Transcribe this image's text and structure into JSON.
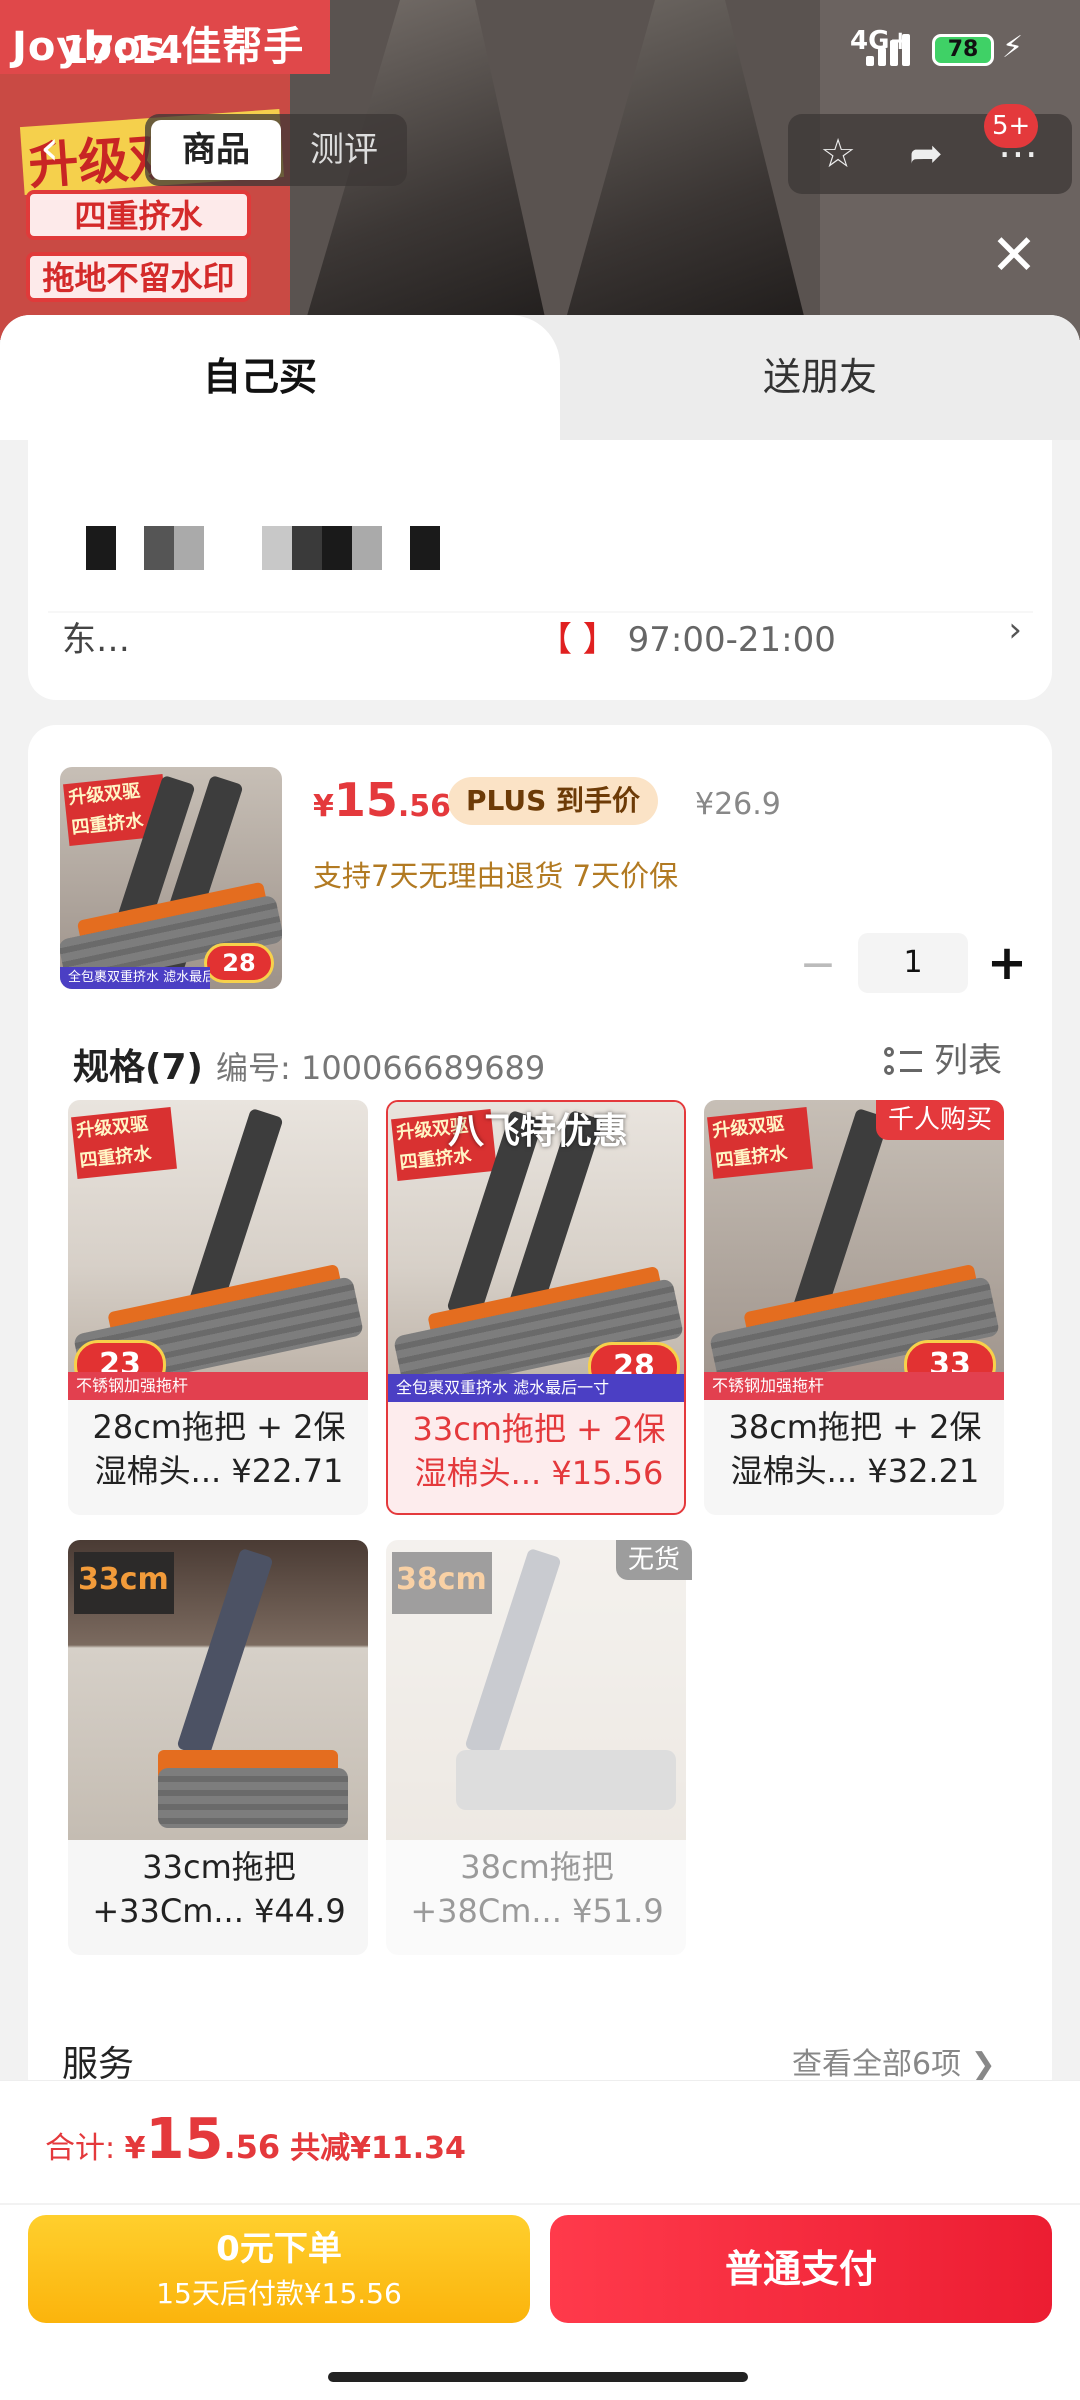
{
  "status_bar": {
    "time": "17:14",
    "network": "4G+",
    "battery": "78"
  },
  "background_page": {
    "brand": "Joybos 佳帮手",
    "slogan": "升级双驱",
    "tags": [
      "四重挤水",
      "拖地不留水印"
    ]
  },
  "navbar": {
    "tabs": [
      {
        "label": "商品",
        "active": true
      },
      {
        "label": "测评",
        "active": false
      }
    ],
    "cart_badge": "5+"
  },
  "sheet": {
    "tabs": [
      {
        "label": "自己买",
        "active": true
      },
      {
        "label": "送朋友",
        "active": false
      }
    ]
  },
  "address": {
    "row2_prefix": "东…",
    "delivery_text": "97:00-21:00",
    "delivery_prefix": "【 】"
  },
  "product": {
    "price_currency": "¥",
    "price_int": "15",
    "price_dec": ".56",
    "plus_label": "PLUS 到手价",
    "original_price": "¥26.9",
    "promise": "支持7天无理由退货  7天价保",
    "quantity": "1",
    "thumb_tag_price": "28",
    "thumb_strip": "全包裹双重挤水 滤水最后一寸"
  },
  "specs": {
    "title": "规格(7)",
    "number_label": "编号: 100066689689",
    "list_toggle": "列表",
    "items": [
      {
        "line1": "28cm拖把 + 2保",
        "line2": "湿棉头...  ¥22.71",
        "tag_price": "23",
        "strip": "不锈钢加强拖杆",
        "selected": false,
        "corner": "",
        "overlay": ""
      },
      {
        "line1": "33cm拖把 + 2保",
        "line2": "湿棉头...  ¥15.56",
        "tag_price": "28",
        "strip": "全包裹双重挤水 滤水最后一寸",
        "selected": true,
        "corner": "",
        "overlay": "八飞特优惠"
      },
      {
        "line1": "38cm拖把 + 2保",
        "line2": "湿棉头...  ¥32.21",
        "tag_price": "33",
        "strip": "不锈钢加强拖杆",
        "selected": false,
        "corner": "千人购买",
        "overlay": ""
      },
      {
        "line1": "33cm拖把",
        "line2": "+33Cm...  ¥44.9",
        "tag_price": "",
        "strip": "",
        "selected": false,
        "corner": "",
        "overlay": "",
        "badge": "33cm"
      },
      {
        "line1": "38cm拖把",
        "line2": "+38Cm...  ¥51.9",
        "tag_price": "",
        "strip": "",
        "selected": false,
        "corner": "无货",
        "overlay": "",
        "badge": "38cm"
      }
    ]
  },
  "service": {
    "title": "服务",
    "see_all": "查看全部6项  ❯"
  },
  "footer": {
    "total_label": "合计: ",
    "total_currency": "¥",
    "total_int": "15",
    "total_dec": ".56",
    "saved": "共减¥11.34",
    "btn_zero_line1": "0元下单",
    "btn_zero_line2": "15天后付款¥15.56",
    "btn_pay": "普通支付"
  },
  "colors": {
    "accent": "#e4393c",
    "gold": "#b27a22",
    "yellow_button": "#fbb40c"
  },
  "icons": [
    "back-icon",
    "star-icon",
    "share-icon",
    "more-icon",
    "close-icon",
    "list-icon",
    "minus-icon",
    "plus-icon",
    "chevron-right-icon"
  ]
}
